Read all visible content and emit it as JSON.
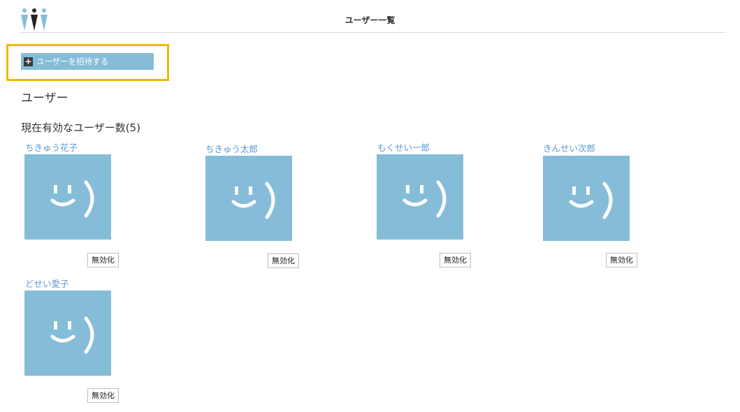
{
  "header": {
    "title": "ユーザー一覧",
    "logo_icon": "people-logo-icon"
  },
  "invite": {
    "icon": "plus-icon",
    "label": "ユーザーを招待する"
  },
  "section": {
    "heading": "ユーザー",
    "count_label": "現在有効なユーザー数(5)"
  },
  "users": [
    {
      "name": "ちきゅう花子",
      "avatar_icon": "smiley-face-icon",
      "action_label": "無効化"
    },
    {
      "name": "ちきゅう太郎",
      "avatar_icon": "smiley-face-icon",
      "action_label": "無効化"
    },
    {
      "name": "もくせい一郎",
      "avatar_icon": "smiley-face-icon",
      "action_label": "無効化"
    },
    {
      "name": "きんせい次郎",
      "avatar_icon": "smiley-face-icon",
      "action_label": "無効化"
    },
    {
      "name": "どせい愛子",
      "avatar_icon": "smiley-face-icon",
      "action_label": "無効化"
    }
  ],
  "colors": {
    "accent": "#85bdd9",
    "link": "#5b9ad1",
    "highlight": "#f5b800"
  }
}
